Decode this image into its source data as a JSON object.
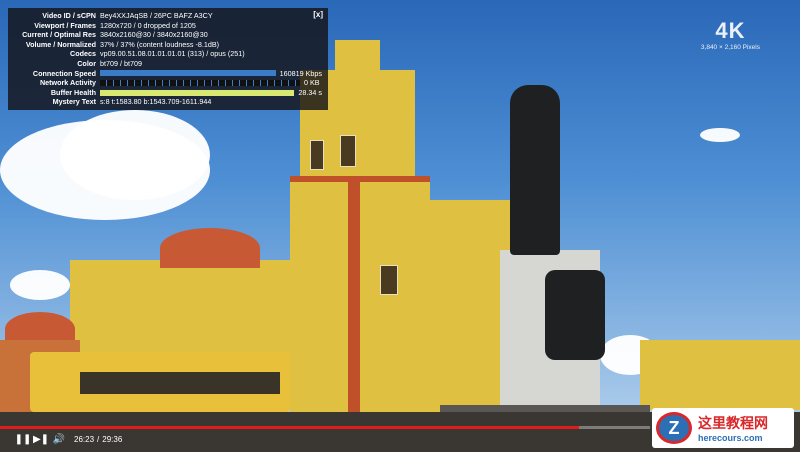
{
  "stats": {
    "close_label": "[x]",
    "rows": [
      {
        "key": "Video ID / sCPN",
        "value": "Bey4XXJAqSB / 26PC BAFZ A3CY"
      },
      {
        "key": "Viewport / Frames",
        "value": "1280x720 / 0 dropped of 1205"
      },
      {
        "key": "Current / Optimal Res",
        "value": "3840x2160@30 / 3840x2160@30"
      },
      {
        "key": "Volume / Normalized",
        "value": "37% / 37% (content loudness -8.1dB)"
      },
      {
        "key": "Codecs",
        "value": "vp09.00.51.08.01.01.01.01 (313) / opus (251)"
      },
      {
        "key": "Color",
        "value": "bt709 / bt709"
      },
      {
        "key": "Connection Speed",
        "value": "160819 Kbps"
      },
      {
        "key": "Network Activity",
        "value": "0 KB"
      },
      {
        "key": "Buffer Health",
        "value": "28.34 s"
      },
      {
        "key": "Mystery Text",
        "value": "s:8 t:1583.80 b:1543.709-1611.944"
      }
    ]
  },
  "badge": {
    "label": "4K",
    "resolution": "3,840 × 2,160 Pixels"
  },
  "controls": {
    "current_time": "26:23",
    "duration": "29:36",
    "separator": "/",
    "progress": 0.891
  },
  "watermark": {
    "cn": "这里教程网",
    "en": "herecours.com",
    "logo_letter": "Z"
  },
  "colors": {
    "progress": "#e21b1b",
    "connection_bar": "#3a7cc7",
    "buffer_bar": "#d8e870"
  }
}
